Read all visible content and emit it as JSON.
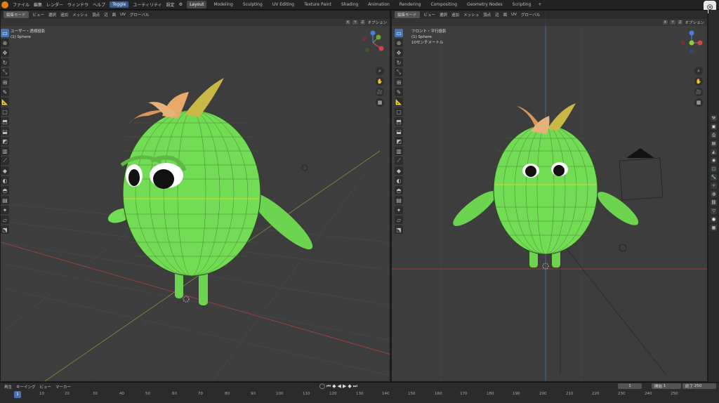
{
  "topbar": {
    "menus": [
      "ファイル",
      "編集",
      "レンダー",
      "ウィンドウ",
      "ヘルプ"
    ],
    "toggle": "Toggle",
    "menus2": [
      "ユーティリティ",
      "設定"
    ],
    "workspaces": [
      "Layout",
      "Modeling",
      "Sculpting",
      "UV Editing",
      "Texture Paint",
      "Shading",
      "Animation",
      "Rendering",
      "Compositing",
      "Geometry Nodes",
      "Scripting"
    ],
    "active_workspace": "Layout",
    "plus": "+"
  },
  "viewport_left": {
    "mode": "編集モード",
    "menus": [
      "ビュー",
      "選択",
      "追加",
      "メッシュ",
      "頂点",
      "辺",
      "面",
      "UV"
    ],
    "transform": "グローバル",
    "axes": [
      "X",
      "Y",
      "Z"
    ],
    "options": "オプション",
    "info_line1": "ユーザー・透視投影",
    "info_line2": "(1) Sphere"
  },
  "viewport_right": {
    "mode": "編集モード",
    "menus": [
      "ビュー",
      "選択",
      "追加",
      "メッシュ",
      "頂点",
      "辺",
      "面",
      "UV"
    ],
    "transform": "グローバル",
    "axes": [
      "X",
      "Y",
      "Z"
    ],
    "options": "オプション",
    "info_line1": "フロント・平行投影",
    "info_line2": "(1) Sphere",
    "info_line3": "10センチメートル"
  },
  "timeline": {
    "menus": [
      "再生",
      "キーイング",
      "ビュー",
      "マーカー"
    ],
    "current_frame": "1",
    "start_label": "開始",
    "start_value": "1",
    "end_label": "終了",
    "end_value": "250",
    "ruler": [
      "1",
      "10",
      "20",
      "30",
      "40",
      "50",
      "60",
      "70",
      "80",
      "90",
      "100",
      "110",
      "120",
      "130",
      "140",
      "150",
      "160",
      "170",
      "180",
      "190",
      "200",
      "210",
      "220",
      "230",
      "240",
      "250"
    ]
  },
  "colors": {
    "body_green": "#72dc54",
    "hair_orange": "#d9955a",
    "hair_yellow": "#c9b845",
    "viewport_bg": "#3d3d3d",
    "accent_blue": "#4772b3"
  }
}
